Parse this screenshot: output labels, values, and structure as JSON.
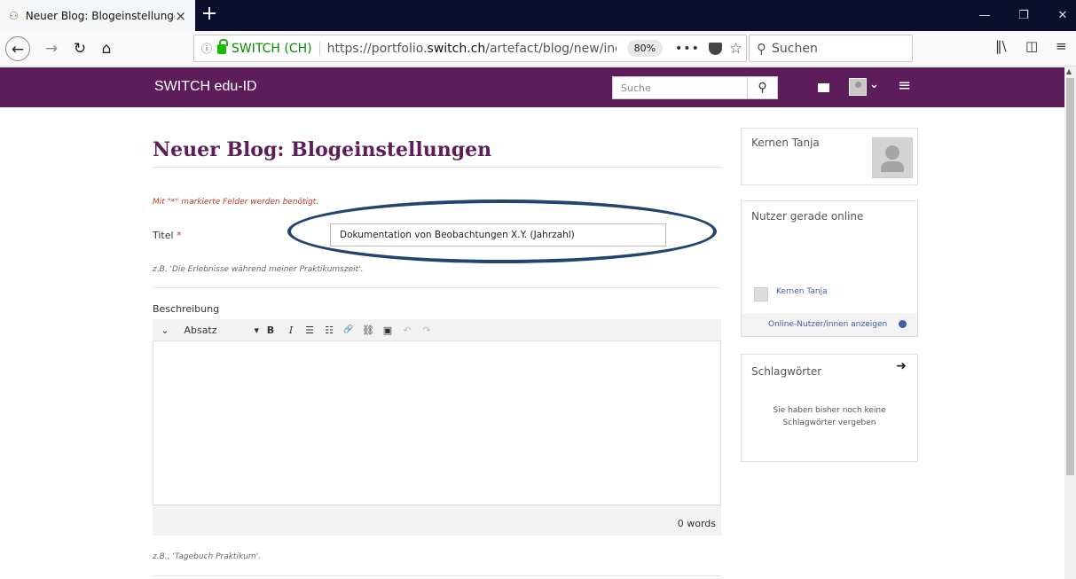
{
  "browser": {
    "tab_title": "Neuer Blog: Blogeinstellungen",
    "tab_close": "×",
    "new_tab": "+",
    "site_identity": "SWITCH (CH)",
    "url_prefix": "https://portfolio.",
    "url_domain": "switch.ch",
    "url_path": "/artefact/blog/new/index.ph",
    "zoom": "80%",
    "page_actions": "•••",
    "search_placeholder": "Suchen"
  },
  "site": {
    "brand": "SWITCH edu-ID",
    "search_placeholder": "Suche"
  },
  "page": {
    "title": "Neuer Blog: Blogeinstellungen",
    "required_note": "Mit \"*\" markierte Felder werden benötigt.",
    "title_label": "Titel",
    "required_marker": "*",
    "title_value": "Dokumentation von Beobachtungen X.Y. (Jahrzahl)",
    "title_hint": "z.B. 'Die Erlebnisse während meiner Praktikumszeit'.",
    "description_label": "Beschreibung",
    "format_select": "Absatz",
    "word_count": "0 words",
    "tags_hint": "z.B., 'Tagebuch Praktikum'."
  },
  "toolbar": {
    "collapse": "⌄",
    "format_caret": "▾",
    "bold": "B",
    "italic": "I",
    "bullet_list": "☰",
    "numbered_list": "☷",
    "link": "🔗",
    "unlink": "⛓",
    "image": "▣",
    "undo": "↶",
    "redo": "↷"
  },
  "sidebar": {
    "profile_name": "Kernen Tanja",
    "online_heading": "Nutzer gerade online",
    "online_user": "Kernen Tanja",
    "online_link": "Online-Nutzer/innen anzeigen",
    "tags_heading": "Schlagwörter",
    "tags_empty_line1": "Sie haben bisher noch keine",
    "tags_empty_line2": "Schlagwörter vergeben"
  },
  "colors": {
    "header": "#5c1d5a",
    "accent_link": "#3e5ea8",
    "required": "#c0392b",
    "highlight_ellipse": "#21456f"
  }
}
